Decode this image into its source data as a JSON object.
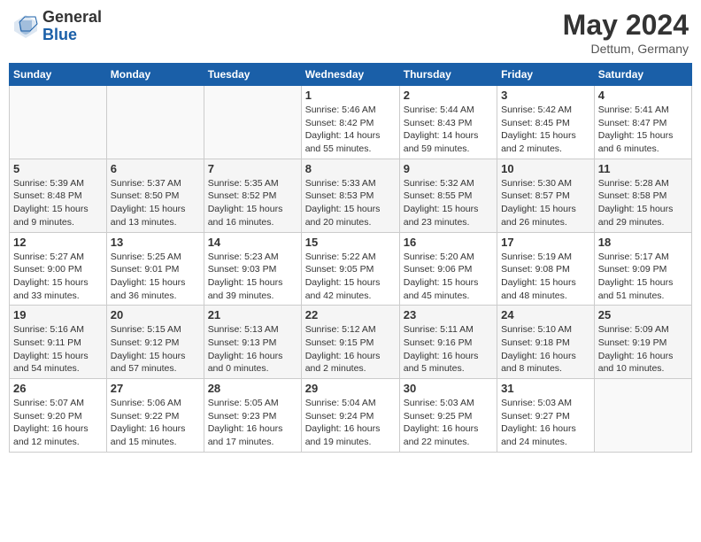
{
  "header": {
    "logo_general": "General",
    "logo_blue": "Blue",
    "month_year": "May 2024",
    "location": "Dettum, Germany"
  },
  "weekdays": [
    "Sunday",
    "Monday",
    "Tuesday",
    "Wednesday",
    "Thursday",
    "Friday",
    "Saturday"
  ],
  "weeks": [
    [
      {
        "day": "",
        "info": ""
      },
      {
        "day": "",
        "info": ""
      },
      {
        "day": "",
        "info": ""
      },
      {
        "day": "1",
        "info": "Sunrise: 5:46 AM\nSunset: 8:42 PM\nDaylight: 14 hours\nand 55 minutes."
      },
      {
        "day": "2",
        "info": "Sunrise: 5:44 AM\nSunset: 8:43 PM\nDaylight: 14 hours\nand 59 minutes."
      },
      {
        "day": "3",
        "info": "Sunrise: 5:42 AM\nSunset: 8:45 PM\nDaylight: 15 hours\nand 2 minutes."
      },
      {
        "day": "4",
        "info": "Sunrise: 5:41 AM\nSunset: 8:47 PM\nDaylight: 15 hours\nand 6 minutes."
      }
    ],
    [
      {
        "day": "5",
        "info": "Sunrise: 5:39 AM\nSunset: 8:48 PM\nDaylight: 15 hours\nand 9 minutes."
      },
      {
        "day": "6",
        "info": "Sunrise: 5:37 AM\nSunset: 8:50 PM\nDaylight: 15 hours\nand 13 minutes."
      },
      {
        "day": "7",
        "info": "Sunrise: 5:35 AM\nSunset: 8:52 PM\nDaylight: 15 hours\nand 16 minutes."
      },
      {
        "day": "8",
        "info": "Sunrise: 5:33 AM\nSunset: 8:53 PM\nDaylight: 15 hours\nand 20 minutes."
      },
      {
        "day": "9",
        "info": "Sunrise: 5:32 AM\nSunset: 8:55 PM\nDaylight: 15 hours\nand 23 minutes."
      },
      {
        "day": "10",
        "info": "Sunrise: 5:30 AM\nSunset: 8:57 PM\nDaylight: 15 hours\nand 26 minutes."
      },
      {
        "day": "11",
        "info": "Sunrise: 5:28 AM\nSunset: 8:58 PM\nDaylight: 15 hours\nand 29 minutes."
      }
    ],
    [
      {
        "day": "12",
        "info": "Sunrise: 5:27 AM\nSunset: 9:00 PM\nDaylight: 15 hours\nand 33 minutes."
      },
      {
        "day": "13",
        "info": "Sunrise: 5:25 AM\nSunset: 9:01 PM\nDaylight: 15 hours\nand 36 minutes."
      },
      {
        "day": "14",
        "info": "Sunrise: 5:23 AM\nSunset: 9:03 PM\nDaylight: 15 hours\nand 39 minutes."
      },
      {
        "day": "15",
        "info": "Sunrise: 5:22 AM\nSunset: 9:05 PM\nDaylight: 15 hours\nand 42 minutes."
      },
      {
        "day": "16",
        "info": "Sunrise: 5:20 AM\nSunset: 9:06 PM\nDaylight: 15 hours\nand 45 minutes."
      },
      {
        "day": "17",
        "info": "Sunrise: 5:19 AM\nSunset: 9:08 PM\nDaylight: 15 hours\nand 48 minutes."
      },
      {
        "day": "18",
        "info": "Sunrise: 5:17 AM\nSunset: 9:09 PM\nDaylight: 15 hours\nand 51 minutes."
      }
    ],
    [
      {
        "day": "19",
        "info": "Sunrise: 5:16 AM\nSunset: 9:11 PM\nDaylight: 15 hours\nand 54 minutes."
      },
      {
        "day": "20",
        "info": "Sunrise: 5:15 AM\nSunset: 9:12 PM\nDaylight: 15 hours\nand 57 minutes."
      },
      {
        "day": "21",
        "info": "Sunrise: 5:13 AM\nSunset: 9:13 PM\nDaylight: 16 hours\nand 0 minutes."
      },
      {
        "day": "22",
        "info": "Sunrise: 5:12 AM\nSunset: 9:15 PM\nDaylight: 16 hours\nand 2 minutes."
      },
      {
        "day": "23",
        "info": "Sunrise: 5:11 AM\nSunset: 9:16 PM\nDaylight: 16 hours\nand 5 minutes."
      },
      {
        "day": "24",
        "info": "Sunrise: 5:10 AM\nSunset: 9:18 PM\nDaylight: 16 hours\nand 8 minutes."
      },
      {
        "day": "25",
        "info": "Sunrise: 5:09 AM\nSunset: 9:19 PM\nDaylight: 16 hours\nand 10 minutes."
      }
    ],
    [
      {
        "day": "26",
        "info": "Sunrise: 5:07 AM\nSunset: 9:20 PM\nDaylight: 16 hours\nand 12 minutes."
      },
      {
        "day": "27",
        "info": "Sunrise: 5:06 AM\nSunset: 9:22 PM\nDaylight: 16 hours\nand 15 minutes."
      },
      {
        "day": "28",
        "info": "Sunrise: 5:05 AM\nSunset: 9:23 PM\nDaylight: 16 hours\nand 17 minutes."
      },
      {
        "day": "29",
        "info": "Sunrise: 5:04 AM\nSunset: 9:24 PM\nDaylight: 16 hours\nand 19 minutes."
      },
      {
        "day": "30",
        "info": "Sunrise: 5:03 AM\nSunset: 9:25 PM\nDaylight: 16 hours\nand 22 minutes."
      },
      {
        "day": "31",
        "info": "Sunrise: 5:03 AM\nSunset: 9:27 PM\nDaylight: 16 hours\nand 24 minutes."
      },
      {
        "day": "",
        "info": ""
      }
    ]
  ]
}
